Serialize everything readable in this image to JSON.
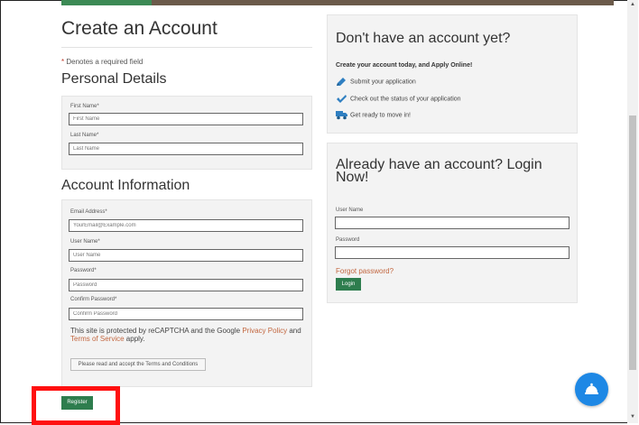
{
  "create": {
    "title": "Create an Account",
    "required_star": "*",
    "required_note": "Denotes a required field",
    "personal": {
      "heading": "Personal Details",
      "first_name_label": "First Name*",
      "first_name_placeholder": "First Name",
      "last_name_label": "Last Name*",
      "last_name_placeholder": "Last Name"
    },
    "account": {
      "heading": "Account Information",
      "email_label": "Email Address*",
      "email_placeholder": "YourEmail@Example.com",
      "username_label": "User Name*",
      "username_placeholder": "User Name",
      "password_label": "Password*",
      "password_placeholder": "Password",
      "confirm_label": "Confirm Password*",
      "confirm_placeholder": "Confirm Password"
    },
    "captcha": {
      "pre": "This site is protected by reCAPTCHA and the Google ",
      "privacy": "Privacy Policy",
      "and": " and ",
      "terms": "Terms of Service",
      "post": " apply."
    },
    "terms_button": "Please read and accept the Terms and Conditions",
    "register_button": "Register"
  },
  "promo": {
    "heading": "Don't have an account yet?",
    "subheading": "Create your account today, and Apply Online!",
    "features": [
      {
        "icon": "pencil-icon",
        "text": "Submit your application"
      },
      {
        "icon": "checkmark-icon",
        "text": "Check out the status of your application"
      },
      {
        "icon": "truck-icon",
        "text": "Get ready to move in!"
      }
    ]
  },
  "login": {
    "heading": "Already have an account? Login Now!",
    "username_label": "User Name",
    "password_label": "Password",
    "forgot": "Forgot password?",
    "button": "Login"
  },
  "colors": {
    "accent_link": "#c2663f",
    "button_green": "#2e7d4e",
    "chat_blue": "#1e88e5",
    "highlight_red": "#ff1010"
  }
}
